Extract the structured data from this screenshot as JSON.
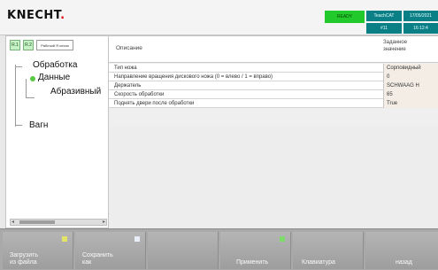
{
  "header": {
    "logo": "KNECHT",
    "status_green": "READY",
    "status_boxes": [
      "TeachCAT",
      "17/05/2021",
      "#11",
      "16:12:4"
    ]
  },
  "left_panel": {
    "mini_buttons": [
      "R.1",
      "R.2"
    ],
    "mini_select": "Рабочий Я сесия",
    "tree": [
      "Обработка",
      "Данные",
      "Абразивный",
      "Вагн"
    ]
  },
  "table": {
    "header": {
      "description": "Описание",
      "value_line1": "Заданное",
      "value_line2": "значение"
    },
    "rows": [
      {
        "description": "Тип ножа",
        "value": "Сорповидный"
      },
      {
        "description": "Направление вращения дискового ножа (0 = влево / 1 = вправо)",
        "value": "0"
      },
      {
        "description": "Держатель",
        "value": "SCHWAAG H"
      },
      {
        "description": "Скорость обработки",
        "value": "65"
      },
      {
        "description": "Поднять двери после обработки",
        "value": "True"
      }
    ]
  },
  "softkeys": [
    {
      "line1": "Загрузить",
      "line2": "из файла"
    },
    {
      "line1": "Сохранить",
      "line2": "как"
    },
    {
      "line1": "",
      "line2": ""
    },
    {
      "line1": "",
      "line2": "Применить"
    },
    {
      "line1": "",
      "line2": "Клавиатура"
    },
    {
      "line1": "",
      "line2": "назад"
    }
  ],
  "colors": {
    "status_green": "#22c92a",
    "status_teal": "#0a7f86",
    "tree_dot": "#58c742",
    "softkey_bg": "#a9a9a9"
  }
}
